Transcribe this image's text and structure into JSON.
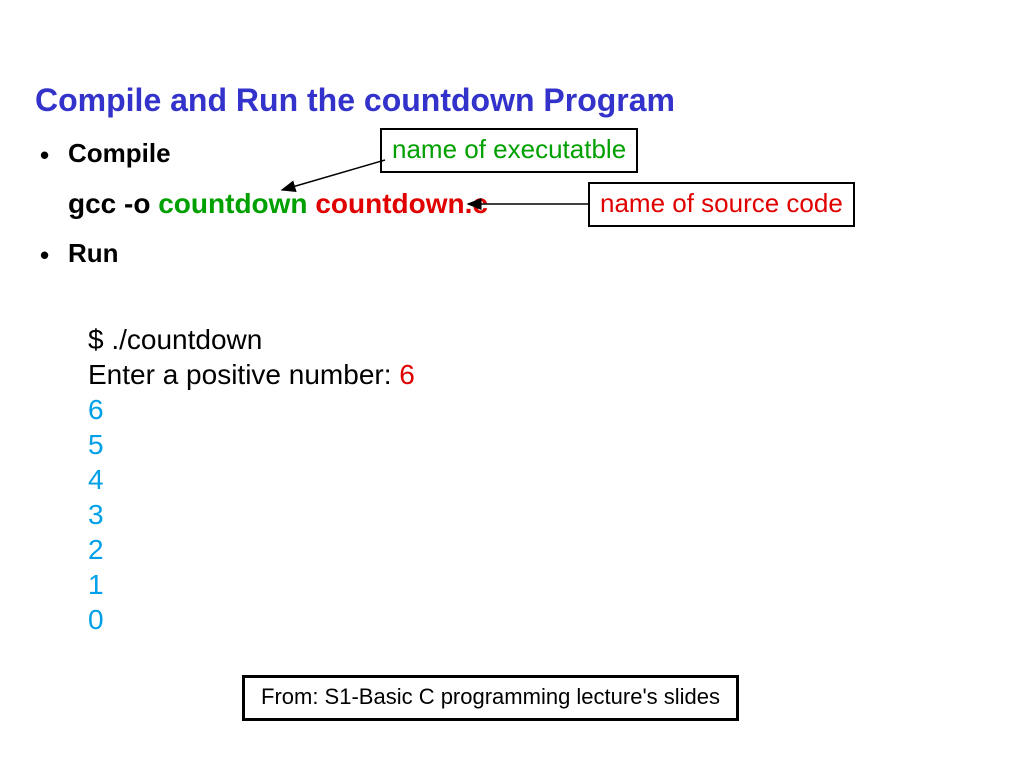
{
  "title": "Compile and Run the countdown Program",
  "bullets": {
    "compile": "Compile",
    "run": "Run"
  },
  "command": {
    "gcc": "gcc -o ",
    "exe": "countdown ",
    "src": "countdown.c"
  },
  "annotations": {
    "executable": "name of executatble",
    "source": "name of source code"
  },
  "run": {
    "invoke": "$ ./countdown",
    "prompt": "Enter a positive number: ",
    "input": "6",
    "output": [
      "6",
      "5",
      "4",
      "3",
      "2",
      "1",
      "0"
    ]
  },
  "footnote": "From: S1-Basic C programming lecture's slides"
}
